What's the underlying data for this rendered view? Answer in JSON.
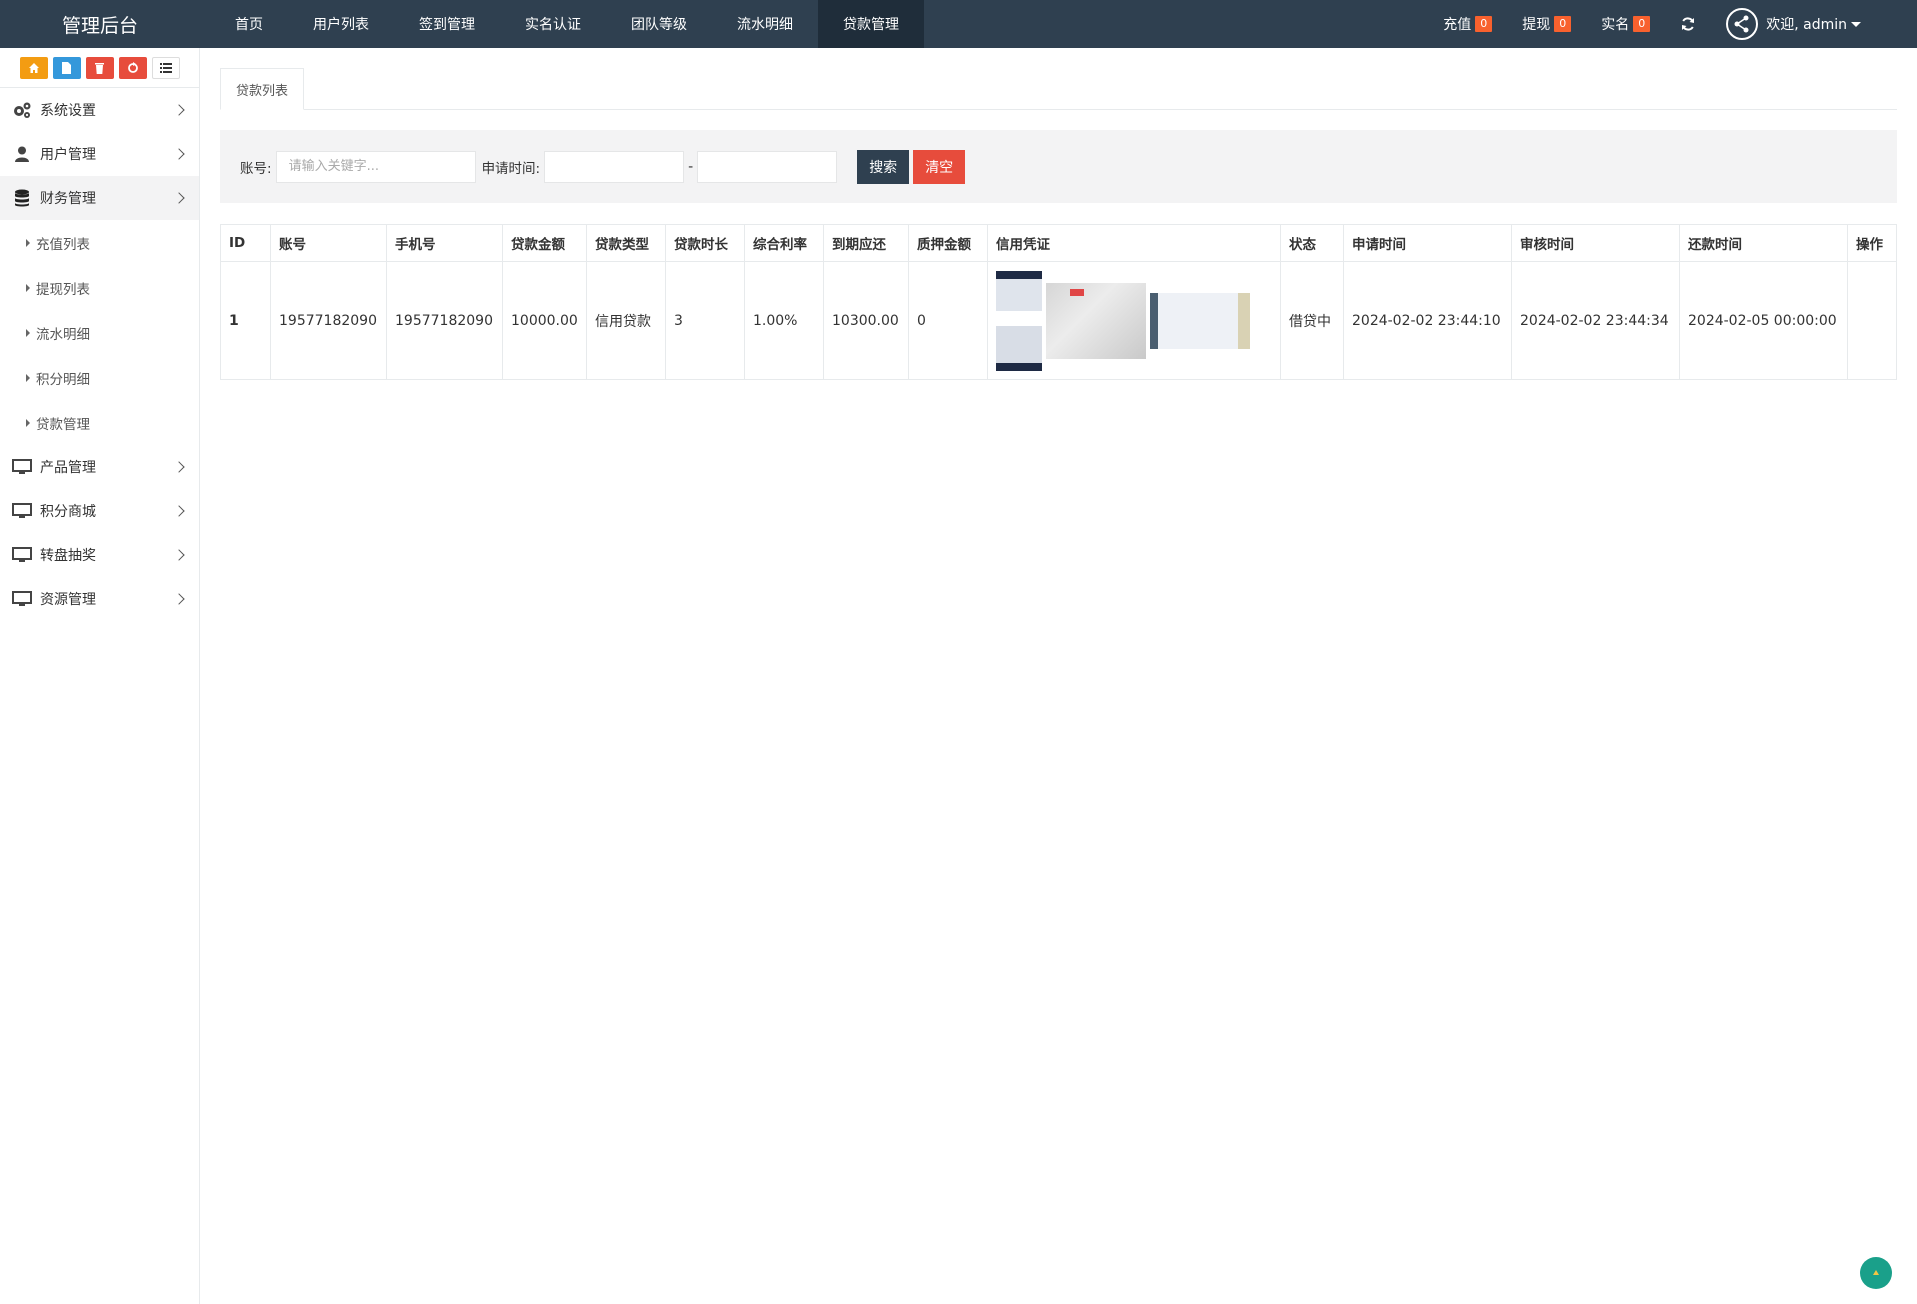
{
  "brand": "管理后台",
  "topnav": [
    {
      "label": "首页"
    },
    {
      "label": "用户列表"
    },
    {
      "label": "签到管理"
    },
    {
      "label": "实名认证"
    },
    {
      "label": "团队等级"
    },
    {
      "label": "流水明细"
    },
    {
      "label": "贷款管理"
    }
  ],
  "topright": {
    "recharge_label": "充值",
    "recharge_count": "0",
    "withdraw_label": "提现",
    "withdraw_count": "0",
    "realname_label": "实名",
    "realname_count": "0",
    "welcome": "欢迎, admin"
  },
  "sidebar": {
    "menu": [
      {
        "label": "系统设置",
        "icon": "gears-icon"
      },
      {
        "label": "用户管理",
        "icon": "user-icon"
      },
      {
        "label": "财务管理",
        "icon": "database-icon"
      },
      {
        "label": "产品管理",
        "icon": "monitor-icon"
      },
      {
        "label": "积分商城",
        "icon": "monitor-icon"
      },
      {
        "label": "转盘抽奖",
        "icon": "monitor-icon"
      },
      {
        "label": "资源管理",
        "icon": "monitor-icon"
      }
    ],
    "finance_sub": [
      {
        "label": "充值列表"
      },
      {
        "label": "提现列表"
      },
      {
        "label": "流水明细"
      },
      {
        "label": "积分明细"
      },
      {
        "label": "贷款管理"
      }
    ]
  },
  "tab": "贷款列表",
  "search": {
    "account_label": "账号:",
    "account_placeholder": "请输入关键字...",
    "time_label": "申请时间:",
    "dash": "-",
    "search_btn": "搜索",
    "clear_btn": "清空"
  },
  "table": {
    "headers": [
      "ID",
      "账号",
      "手机号",
      "贷款金额",
      "贷款类型",
      "贷款时长",
      "综合利率",
      "到期应还",
      "质押金额",
      "信用凭证",
      "状态",
      "申请时间",
      "审核时间",
      "还款时间",
      "操作"
    ],
    "rows": [
      {
        "id": "1",
        "account": "19577182090",
        "phone": "19577182090",
        "amount": "10000.00",
        "type": "信用贷款",
        "duration": "3",
        "rate": "1.00%",
        "due": "10300.00",
        "pledge": "0",
        "status": "借贷中",
        "apply_time": "2024-02-02 23:44:10",
        "review_time": "2024-02-02 23:44:34",
        "repay_time": "2024-02-05 00:00:00",
        "action": ""
      }
    ]
  }
}
